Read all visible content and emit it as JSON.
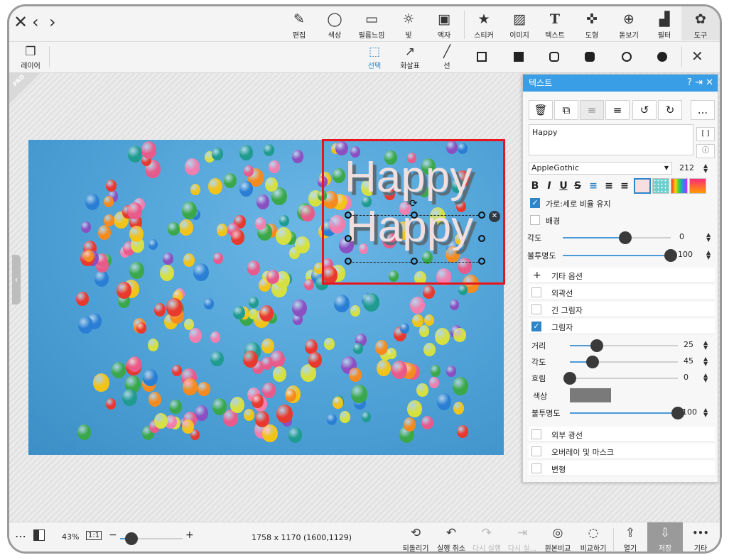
{
  "nav": {
    "close": "✕",
    "back": "‹",
    "forward": "›"
  },
  "toolbar": [
    {
      "label": "편집",
      "icon": "✎"
    },
    {
      "label": "색상",
      "icon": "◯"
    },
    {
      "label": "필름느낌",
      "icon": "▭"
    },
    {
      "label": "빛",
      "icon": "☼"
    },
    {
      "label": "액자",
      "icon": "▣"
    },
    {
      "label": "스티커",
      "icon": "★"
    },
    {
      "label": "이미지",
      "icon": "▨"
    },
    {
      "label": "텍스트",
      "icon": "T"
    },
    {
      "label": "도형",
      "icon": "✜"
    },
    {
      "label": "돋보기",
      "icon": "⊕"
    },
    {
      "label": "필터",
      "icon": "▟"
    },
    {
      "label": "도구",
      "icon": "✿"
    }
  ],
  "toolbar2": {
    "layer": {
      "label": "레이어",
      "icon": "❐"
    },
    "select": {
      "label": "선택",
      "icon": "⬚"
    },
    "arrow": {
      "label": "화살표",
      "icon": "↗"
    },
    "line": {
      "label": "선",
      "icon": "╱"
    },
    "close": "✕"
  },
  "pro_badge": "PRO",
  "canvas": {
    "text_line1": "Happy",
    "text_line2": "Happy"
  },
  "panel": {
    "title": "텍스트",
    "header_icons": "? ⇥ ✕",
    "buttons": [
      "🗑",
      "⧉",
      "≡",
      "≡",
      "↺",
      "↻",
      "..."
    ],
    "text_value": "Happy",
    "bracket_btn": "[ ]",
    "info_btn": "ⓘ",
    "font": "AppleGothic",
    "font_size": "212",
    "format": {
      "bold": "B",
      "italic": "I",
      "underline": "U",
      "strike": "S",
      "align_left": "≡",
      "align_center": "≡",
      "align_right": "≡"
    },
    "keep_ratio": "가로:세로 비율 유지",
    "background": "배경",
    "angle_label": "각도",
    "angle_value": "0",
    "angle_level": 0.58,
    "opacity_label": "불투명도",
    "opacity_value": "100",
    "opacity_level": 1.0,
    "more_options": "기타 옵션",
    "plus": "+",
    "outline": "외곽선",
    "long_shadow": "긴 그림자",
    "shadow": "그림자",
    "distance_label": "거리",
    "distance_value": "25",
    "distance_level": 0.25,
    "shadow_angle_label": "각도",
    "shadow_angle_value": "45",
    "shadow_angle_level": 0.21,
    "blur_label": "흐림",
    "blur_value": "0",
    "blur_level": 0.0,
    "color_label": "색상",
    "shadow_color": "#7a7a7a",
    "shadow_opacity_label": "불투명도",
    "shadow_opacity_value": "100",
    "shadow_opacity_level": 1.0,
    "outer_glow": "외부 광선",
    "overlay_mask": "오버레이 및 마스크",
    "transform": "변형"
  },
  "bottom": {
    "zoom": "43%",
    "one_to_one": "1:1",
    "minus": "−",
    "plus": "+",
    "dimensions": "1758 x 1170 (1600,1129)",
    "zoom_level": 0.18,
    "actions": [
      {
        "label": "되돌리기",
        "icon": "⟲",
        "state": "normal"
      },
      {
        "label": "실행 취소",
        "icon": "↶",
        "state": "normal"
      },
      {
        "label": "다시 실행",
        "icon": "↷",
        "state": "dim"
      },
      {
        "label": "다시 실...",
        "icon": "⇥",
        "state": "dim"
      },
      {
        "label": "원본비교",
        "icon": "◎",
        "state": "normal"
      },
      {
        "label": "비교하기",
        "icon": "◌",
        "state": "normal"
      },
      {
        "label": "열기",
        "icon": "⇪",
        "state": "normal"
      },
      {
        "label": "저장",
        "icon": "⇩",
        "state": "active"
      },
      {
        "label": "기타",
        "icon": "•••",
        "state": "normal"
      }
    ]
  }
}
